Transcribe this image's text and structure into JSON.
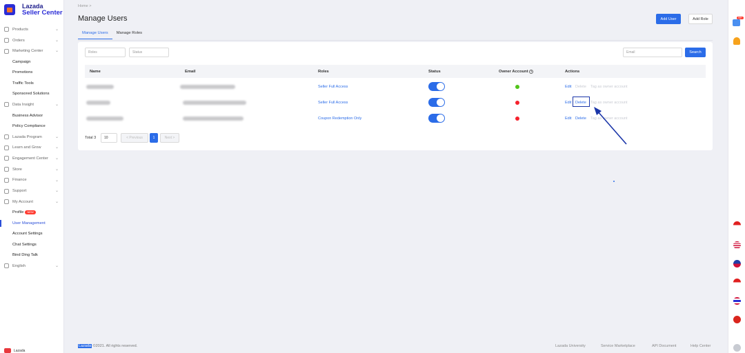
{
  "brand": {
    "line1": "Lazada",
    "line2": "Seller Center"
  },
  "sidebar": {
    "items": [
      {
        "label": "Products",
        "type": "group",
        "caret": "▾"
      },
      {
        "label": "Orders",
        "type": "group"
      },
      {
        "label": "Marketing Center",
        "type": "group"
      },
      {
        "label": "Campaign",
        "type": "sub"
      },
      {
        "label": "Promotions",
        "type": "sub"
      },
      {
        "label": "Traffic Tools",
        "type": "sub"
      },
      {
        "label": "Sponsored Solutions",
        "type": "sub"
      },
      {
        "label": "Data Insight",
        "type": "group"
      },
      {
        "label": "Business Advisor",
        "type": "sub"
      },
      {
        "label": "Policy Compliance",
        "type": "sub"
      },
      {
        "label": "Lazada Program",
        "type": "group"
      },
      {
        "label": "Learn and Grow",
        "type": "group"
      },
      {
        "label": "Engagement Center",
        "type": "group"
      },
      {
        "label": "Store",
        "type": "group"
      },
      {
        "label": "Finance",
        "type": "group"
      },
      {
        "label": "Support",
        "type": "group"
      },
      {
        "label": "My Account",
        "type": "group"
      },
      {
        "label": "Profile",
        "type": "sub",
        "badge": "NEW"
      },
      {
        "label": "User Management",
        "type": "sub",
        "active": true
      },
      {
        "label": "Account Settings",
        "type": "sub"
      },
      {
        "label": "Chat Settings",
        "type": "sub"
      },
      {
        "label": "Bind Ding Talk",
        "type": "sub"
      },
      {
        "label": "English",
        "type": "group"
      }
    ],
    "bottom_label": "Lazada"
  },
  "breadcrumb": "Home  >",
  "page": {
    "title": "Manage Users",
    "add_user": "Add User",
    "add_role": "Add Role"
  },
  "tabs": [
    "Manage Users",
    "Manage Roles"
  ],
  "filters": {
    "roles_placeholder": "Roles",
    "status_placeholder": "Status",
    "email_placeholder": "Email",
    "search_label": "Search"
  },
  "table": {
    "headers": {
      "name": "Name",
      "email": "Email",
      "roles": "Roles",
      "status": "Status",
      "owner": "Owner Account",
      "actions": "Actions"
    },
    "rows": [
      {
        "role": "Seller Full Access",
        "status_on": true,
        "owner": true,
        "actions": [
          "Edit",
          "Delete",
          "Tag as owner account"
        ]
      },
      {
        "role": "Seller Full Access",
        "status_on": true,
        "owner": false,
        "actions": [
          "Edit",
          "Delete",
          "Tag as owner account"
        ]
      },
      {
        "role": "Coupon Redemption Only",
        "status_on": true,
        "owner": false,
        "actions": [
          "Edit",
          "Delete",
          "Tag as owner account"
        ]
      }
    ]
  },
  "pagination": {
    "total": "Total 3",
    "page_size": "10",
    "previous": "< Previous",
    "current": "1",
    "next": "Next >"
  },
  "footer": {
    "brand": "Lazada",
    "copyright": " ©2021. All rights reserved.",
    "links": [
      "Lazada University",
      "Service Marketplace",
      "API Document",
      "Help Center"
    ]
  },
  "colors": {
    "accent": "#2b6ce8",
    "brand": "#2b2dd6",
    "owner_yes": "#52c41a",
    "owner_no": "#f5222d"
  },
  "rail": {
    "notification_badge": "99+"
  }
}
